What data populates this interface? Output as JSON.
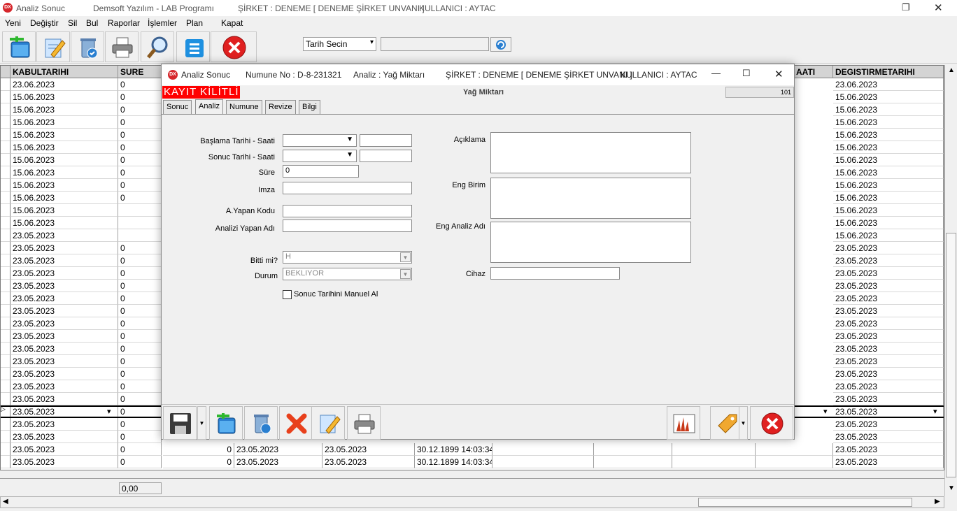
{
  "app": {
    "icon_text": "DX",
    "title": "Analiz Sonuc",
    "company_app": "Demsoft Yazılım - LAB Programı",
    "company": "ŞİRKET : DENEME [ DENEME ŞİRKET UNVANI ]",
    "user": "KULLANICI : AYTAC"
  },
  "menu": [
    "Yeni",
    "Değiştir",
    "Sil",
    "Bul",
    "Raporlar",
    "İşlemler",
    "Plan",
    "Kapat"
  ],
  "toolbar": {
    "date_select": "Tarih Secin",
    "date_value": ""
  },
  "grid": {
    "headers": {
      "kabul": "KABULTARIHI",
      "sure": "SURE",
      "saati": "AATI",
      "degistirme": "DEGISTIRMETARIHI"
    },
    "rows": [
      {
        "kabul": "23.06.2023",
        "sure": "0",
        "degistirme": "23.06.2023"
      },
      {
        "kabul": "15.06.2023",
        "sure": "0",
        "degistirme": "15.06.2023"
      },
      {
        "kabul": "15.06.2023",
        "sure": "0",
        "degistirme": "15.06.2023"
      },
      {
        "kabul": "15.06.2023",
        "sure": "0",
        "degistirme": "15.06.2023"
      },
      {
        "kabul": "15.06.2023",
        "sure": "0",
        "degistirme": "15.06.2023"
      },
      {
        "kabul": "15.06.2023",
        "sure": "0",
        "degistirme": "15.06.2023"
      },
      {
        "kabul": "15.06.2023",
        "sure": "0",
        "degistirme": "15.06.2023"
      },
      {
        "kabul": "15.06.2023",
        "sure": "0",
        "degistirme": "15.06.2023"
      },
      {
        "kabul": "15.06.2023",
        "sure": "0",
        "degistirme": "15.06.2023"
      },
      {
        "kabul": "15.06.2023",
        "sure": "0",
        "degistirme": "15.06.2023"
      },
      {
        "kabul": "15.06.2023",
        "sure": "",
        "degistirme": "15.06.2023"
      },
      {
        "kabul": "15.06.2023",
        "sure": "",
        "degistirme": "15.06.2023"
      },
      {
        "kabul": "23.05.2023",
        "sure": "",
        "degistirme": "15.06.2023"
      },
      {
        "kabul": "23.05.2023",
        "sure": "0",
        "degistirme": "23.05.2023"
      },
      {
        "kabul": "23.05.2023",
        "sure": "0",
        "degistirme": "23.05.2023"
      },
      {
        "kabul": "23.05.2023",
        "sure": "0",
        "degistirme": "23.05.2023"
      },
      {
        "kabul": "23.05.2023",
        "sure": "0",
        "degistirme": "23.05.2023"
      },
      {
        "kabul": "23.05.2023",
        "sure": "0",
        "degistirme": "23.05.2023"
      },
      {
        "kabul": "23.05.2023",
        "sure": "0",
        "degistirme": "23.05.2023"
      },
      {
        "kabul": "23.05.2023",
        "sure": "0",
        "degistirme": "23.05.2023"
      },
      {
        "kabul": "23.05.2023",
        "sure": "0",
        "degistirme": "23.05.2023"
      },
      {
        "kabul": "23.05.2023",
        "sure": "0",
        "degistirme": "23.05.2023"
      },
      {
        "kabul": "23.05.2023",
        "sure": "0",
        "degistirme": "23.05.2023"
      },
      {
        "kabul": "23.05.2023",
        "sure": "0",
        "degistirme": "23.05.2023"
      },
      {
        "kabul": "23.05.2023",
        "sure": "0",
        "degistirme": "23.05.2023"
      },
      {
        "kabul": "23.05.2023",
        "sure": "0",
        "degistirme": "23.05.2023"
      },
      {
        "kabul": "23.05.2023",
        "sure": "0",
        "degistirme": "23.05.2023"
      },
      {
        "kabul": "23.05.2023",
        "sure": "0",
        "degistirme": "23.05.2023"
      },
      {
        "kabul": "23.05.2023",
        "sure": "0",
        "degistirme": "23.05.2023"
      },
      {
        "kabul": "23.05.2023",
        "sure": "0",
        "degistirme": "23.05.2023",
        "c1": "0",
        "c2": "23.05.2023",
        "c3": "23.05.2023",
        "c4": "30.12.1899 14:03:34"
      },
      {
        "kabul": "23.05.2023",
        "sure": "0",
        "degistirme": "23.05.2023",
        "c1": "0",
        "c2": "23.05.2023",
        "c3": "23.05.2023",
        "c4": "30.12.1899 14:03:34"
      }
    ],
    "footer_sum": "0,00"
  },
  "dialog": {
    "icon_text": "DX",
    "title": "Analiz Sonuc",
    "numune": "Numune No : D-8-231321",
    "analiz": "Analiz : Yağ Miktarı",
    "company": "ŞİRKET : DENEME [ DENEME ŞİRKET UNVANI ]",
    "user": "KULLANICI : AYTAC",
    "locked": "KAYIT KİLİTLİ",
    "heading": "Yağ Miktarı",
    "number": "101",
    "tabs": [
      "Sonuc",
      "Analiz",
      "Numune",
      "Revize",
      "Bilgi"
    ],
    "active_tab": "Analiz",
    "fields": {
      "baslama_label": "Başlama Tarihi - Saati",
      "sonuc_label": "Sonuc Tarihi - Saati",
      "sure_label": "Süre",
      "sure_value": "0",
      "imza_label": "Imza",
      "ayapan_kodu_label": "A.Yapan Kodu",
      "analizi_yapan_label": "Analizi Yapan Adı",
      "bitti_label": "Bitti mi?",
      "bitti_value": "H",
      "durum_label": "Durum",
      "durum_value": "BEKLIYOR",
      "manuel_label": "Sonuc Tarihini Manuel Al",
      "aciklama_label": "Açıklama",
      "eng_birim_label": "Eng Birim",
      "eng_analiz_label": "Eng Analiz Adı",
      "cihaz_label": "Cihaz"
    }
  },
  "colors": {
    "locked_bg": "#ff0000",
    "close_red": "#e02020",
    "accent_blue": "#1e90e0"
  }
}
